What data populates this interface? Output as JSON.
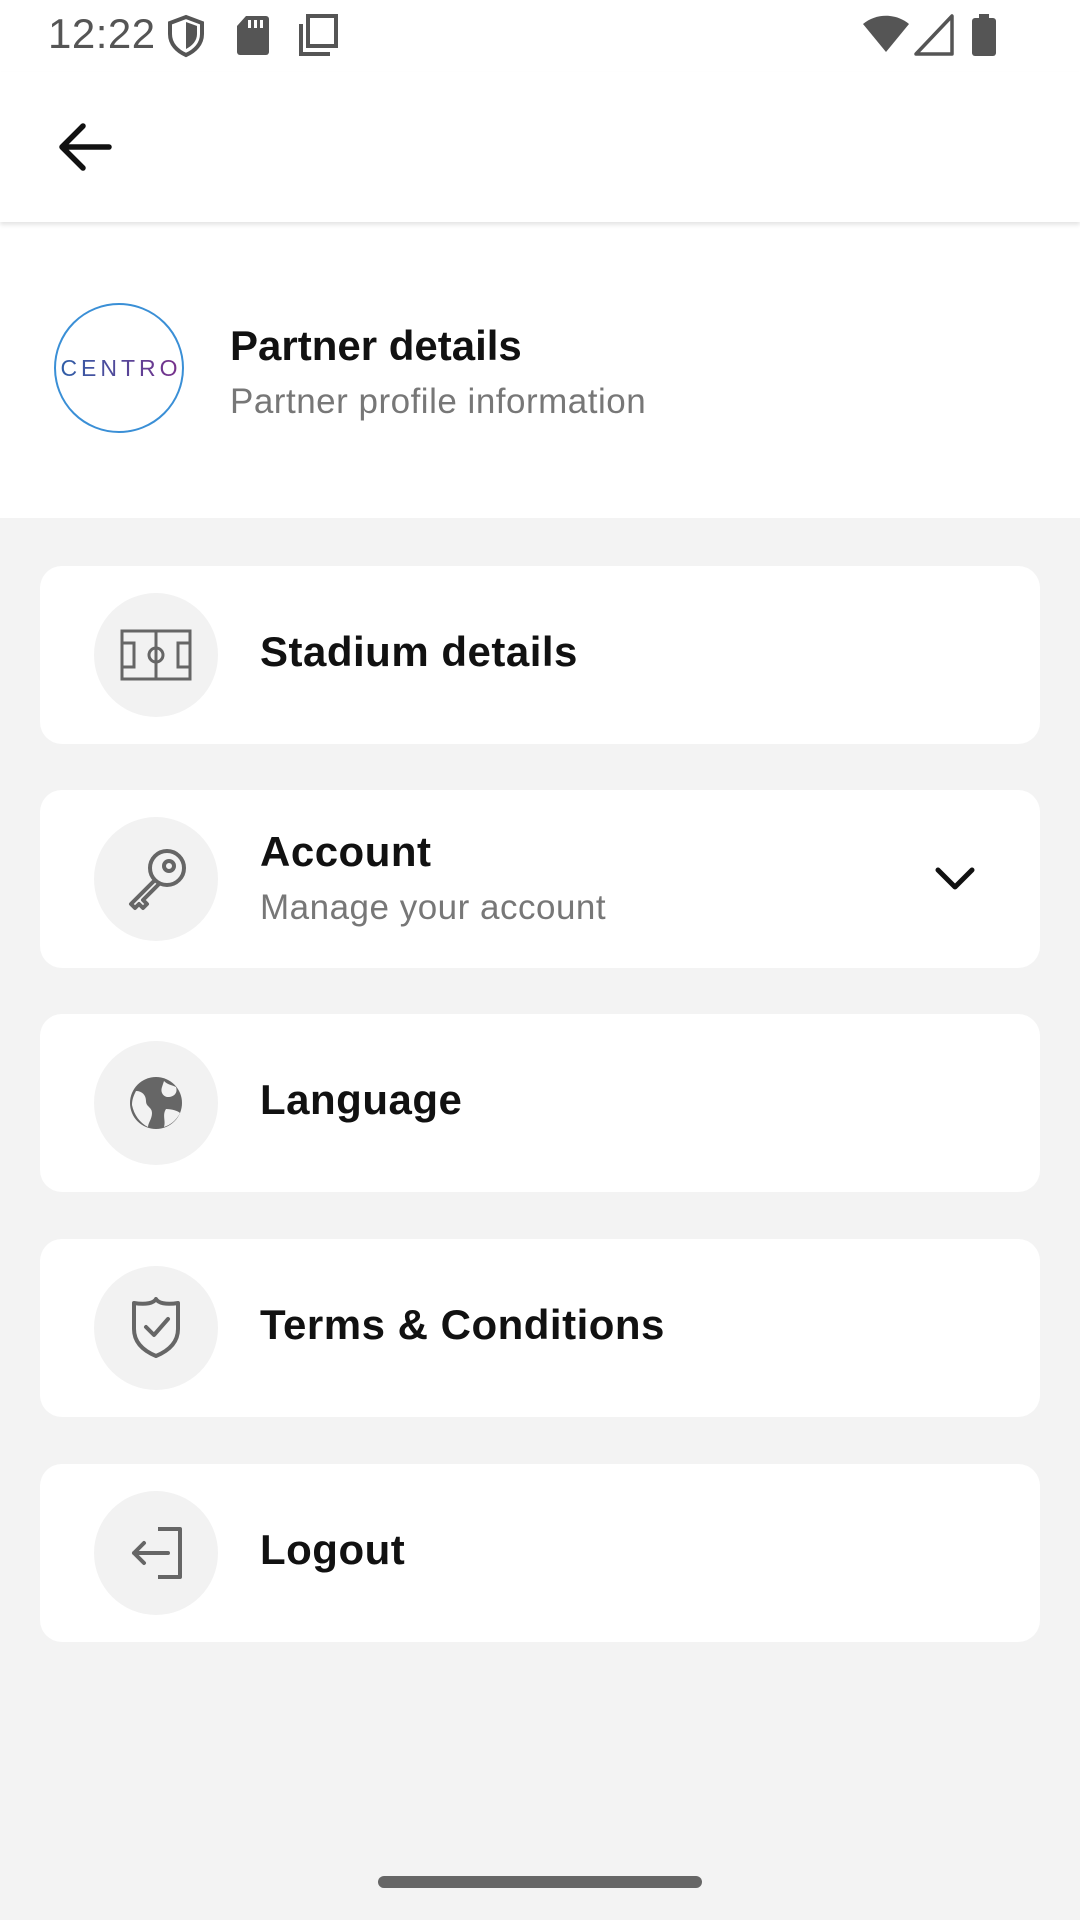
{
  "status_bar": {
    "time": "12:22",
    "icons": [
      "shield-icon",
      "sd-card-icon",
      "copy-icon",
      "wifi-icon",
      "cellular-signal-icon",
      "battery-icon"
    ]
  },
  "app_bar": {
    "back_icon": "arrow-left-icon"
  },
  "partner": {
    "logo_text": "CENTRO",
    "title": "Partner details",
    "subtitle": "Partner profile information"
  },
  "menu": {
    "items": [
      {
        "label": "Stadium details",
        "icon": "stadium-icon"
      },
      {
        "label": "Account",
        "subtitle": "Manage your account",
        "icon": "key-icon",
        "expand_icon": "chevron-down-icon"
      },
      {
        "label": "Language",
        "icon": "globe-icon"
      },
      {
        "label": "Terms & Conditions",
        "icon": "shield-check-icon"
      },
      {
        "label": "Logout",
        "icon": "logout-icon"
      }
    ]
  },
  "colors": {
    "background": "#f3f3f3",
    "card": "#ffffff",
    "icon_circle": "#f2f2f2",
    "logo_ring": "#3a8fd6",
    "secondary_text": "#777777"
  }
}
